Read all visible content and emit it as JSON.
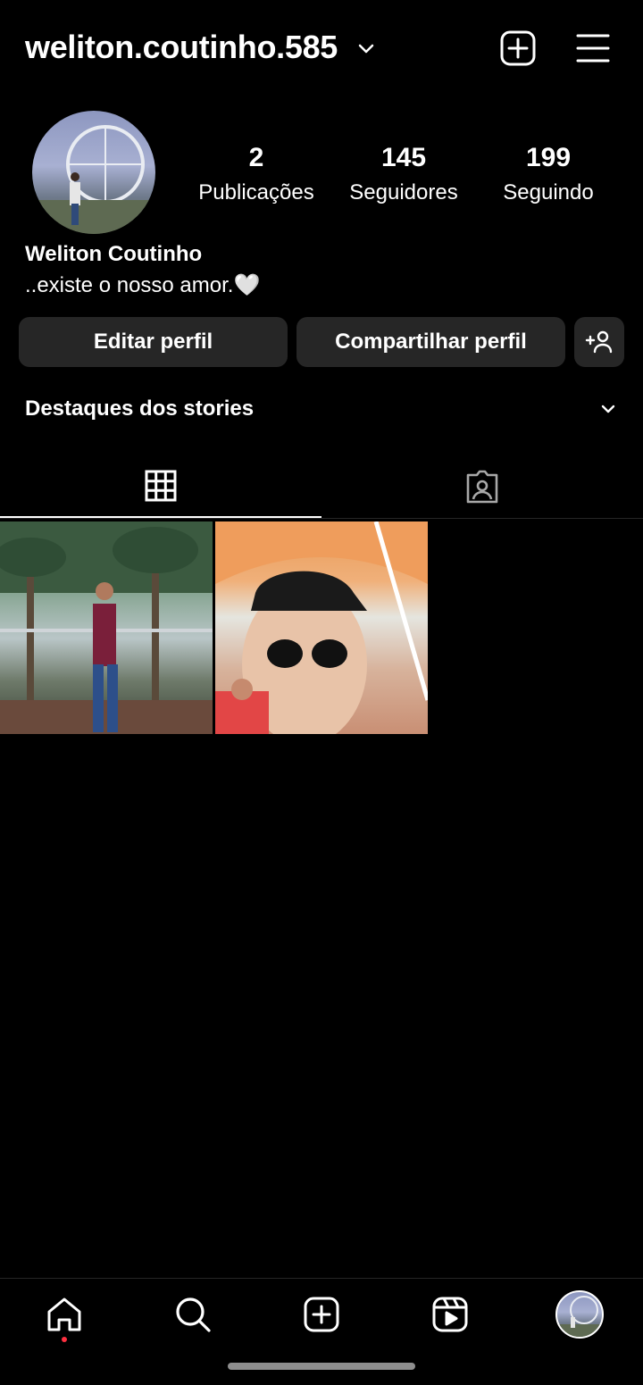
{
  "header": {
    "username": "weliton.coutinho.585"
  },
  "profile": {
    "stats": {
      "posts_count": "2",
      "posts_label": "Publicações",
      "followers_count": "145",
      "followers_label": "Seguidores",
      "following_count": "199",
      "following_label": "Seguindo"
    },
    "full_name": "Weliton Coutinho",
    "bio": "..existe o nosso amor.🤍"
  },
  "actions": {
    "edit_label": "Editar perfil",
    "share_label": "Compartilhar perfil"
  },
  "highlights": {
    "title": "Destaques dos stories"
  },
  "tabs": [
    {
      "icon": "grid-icon",
      "active": true
    },
    {
      "icon": "tagged-icon",
      "active": false
    }
  ],
  "posts": [
    {
      "icon": "photo-thumbnail"
    },
    {
      "icon": "photo-thumbnail"
    }
  ],
  "bottom_nav": {
    "items": [
      "home-icon",
      "search-icon",
      "create-icon",
      "reels-icon",
      "profile-avatar"
    ],
    "active": "home-icon"
  },
  "colors": {
    "background": "#000000",
    "button_bg": "#262626",
    "notification_dot": "#ff3040"
  }
}
